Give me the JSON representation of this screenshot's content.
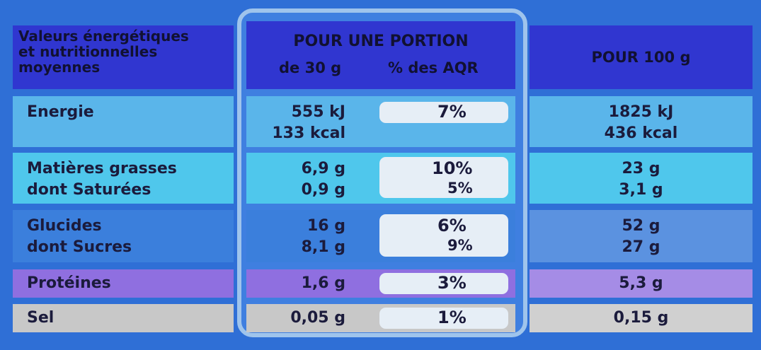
{
  "header": {
    "left_label": [
      "Valeurs énergétiques",
      "et nutritionnelles",
      "moyennes"
    ],
    "mid_title": "POUR UNE PORTION",
    "mid_col1": "de 30 g",
    "mid_col2": "% des AQR",
    "right_title": "POUR 100 g"
  },
  "rows": {
    "energie": {
      "label": "Energie",
      "portion1": "555 kJ",
      "portion2": "133 kcal",
      "pct": "7%",
      "per100_1": "1825 kJ",
      "per100_2": "436 kcal"
    },
    "matieres": {
      "label1": "Matières grasses",
      "label2": "dont Saturées",
      "portion1": "6,9 g",
      "portion2": "0,9 g",
      "pct1": "10%",
      "pct2": "5%",
      "per100_1": "23 g",
      "per100_2": "3,1 g"
    },
    "glucides": {
      "label1": "Glucides",
      "label2": "dont Sucres",
      "portion1": "16 g",
      "portion2": "8,1 g",
      "pct1": "6%",
      "pct2": "9%",
      "per100_1": "52 g",
      "per100_2": "27 g"
    },
    "proteines": {
      "label": "Protéines",
      "portion": "1,6 g",
      "pct": "3%",
      "per100": "5,3 g"
    },
    "sel": {
      "label": "Sel",
      "portion": "0,05 g",
      "pct": "1%",
      "per100": "0,15 g"
    }
  },
  "colors": {
    "background": "#2f6fd6",
    "header": "#3036d0",
    "energie": "#5ab5ea",
    "matieres": "#4fc7ec",
    "glucides": "#3b7fdc",
    "proteines": "#8f6fe0",
    "sel": "#c8c8c8"
  }
}
